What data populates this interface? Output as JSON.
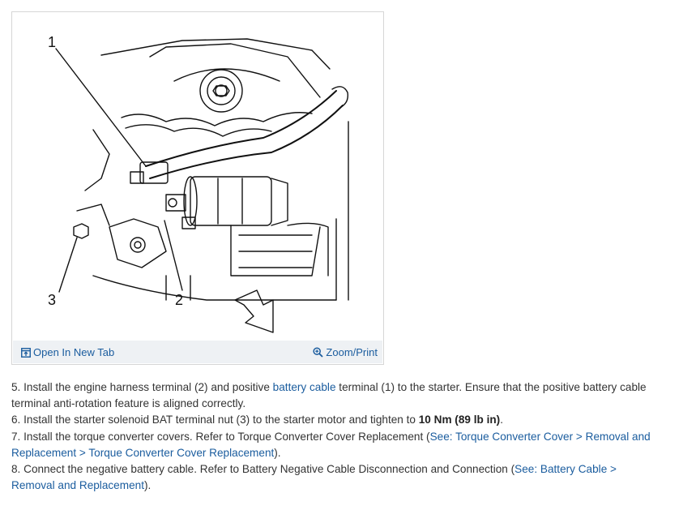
{
  "figure": {
    "callouts": {
      "one": "1",
      "two": "2",
      "three": "3"
    },
    "open_new_tab_label": "Open In New Tab",
    "zoom_print_label": "Zoom/Print"
  },
  "steps": [
    {
      "num": "5.",
      "text_a": "Install the engine harness terminal (2) and positive ",
      "link": "battery cable",
      "text_b": " terminal (1) to the starter. Ensure that the positive battery cable terminal anti-rotation feature is aligned correctly."
    },
    {
      "num": "6.",
      "text_a": "Install the starter solenoid BAT terminal nut (3) to the starter motor and tighten to ",
      "bold": "10 Nm (89 lb in)",
      "text_b": "."
    },
    {
      "num": "7.",
      "text_a": "Install the torque converter covers. Refer to Torque Converter Cover Replacement (",
      "link": "See: Torque Converter Cover > Removal and Replacement > Torque Converter Cover Replacement",
      "text_b": ")."
    },
    {
      "num": "8.",
      "text_a": "Connect the negative battery cable. Refer to Battery Negative Cable Disconnection and Connection (",
      "link": "See: Battery Cable > Removal and Replacement",
      "text_b": ")."
    }
  ]
}
